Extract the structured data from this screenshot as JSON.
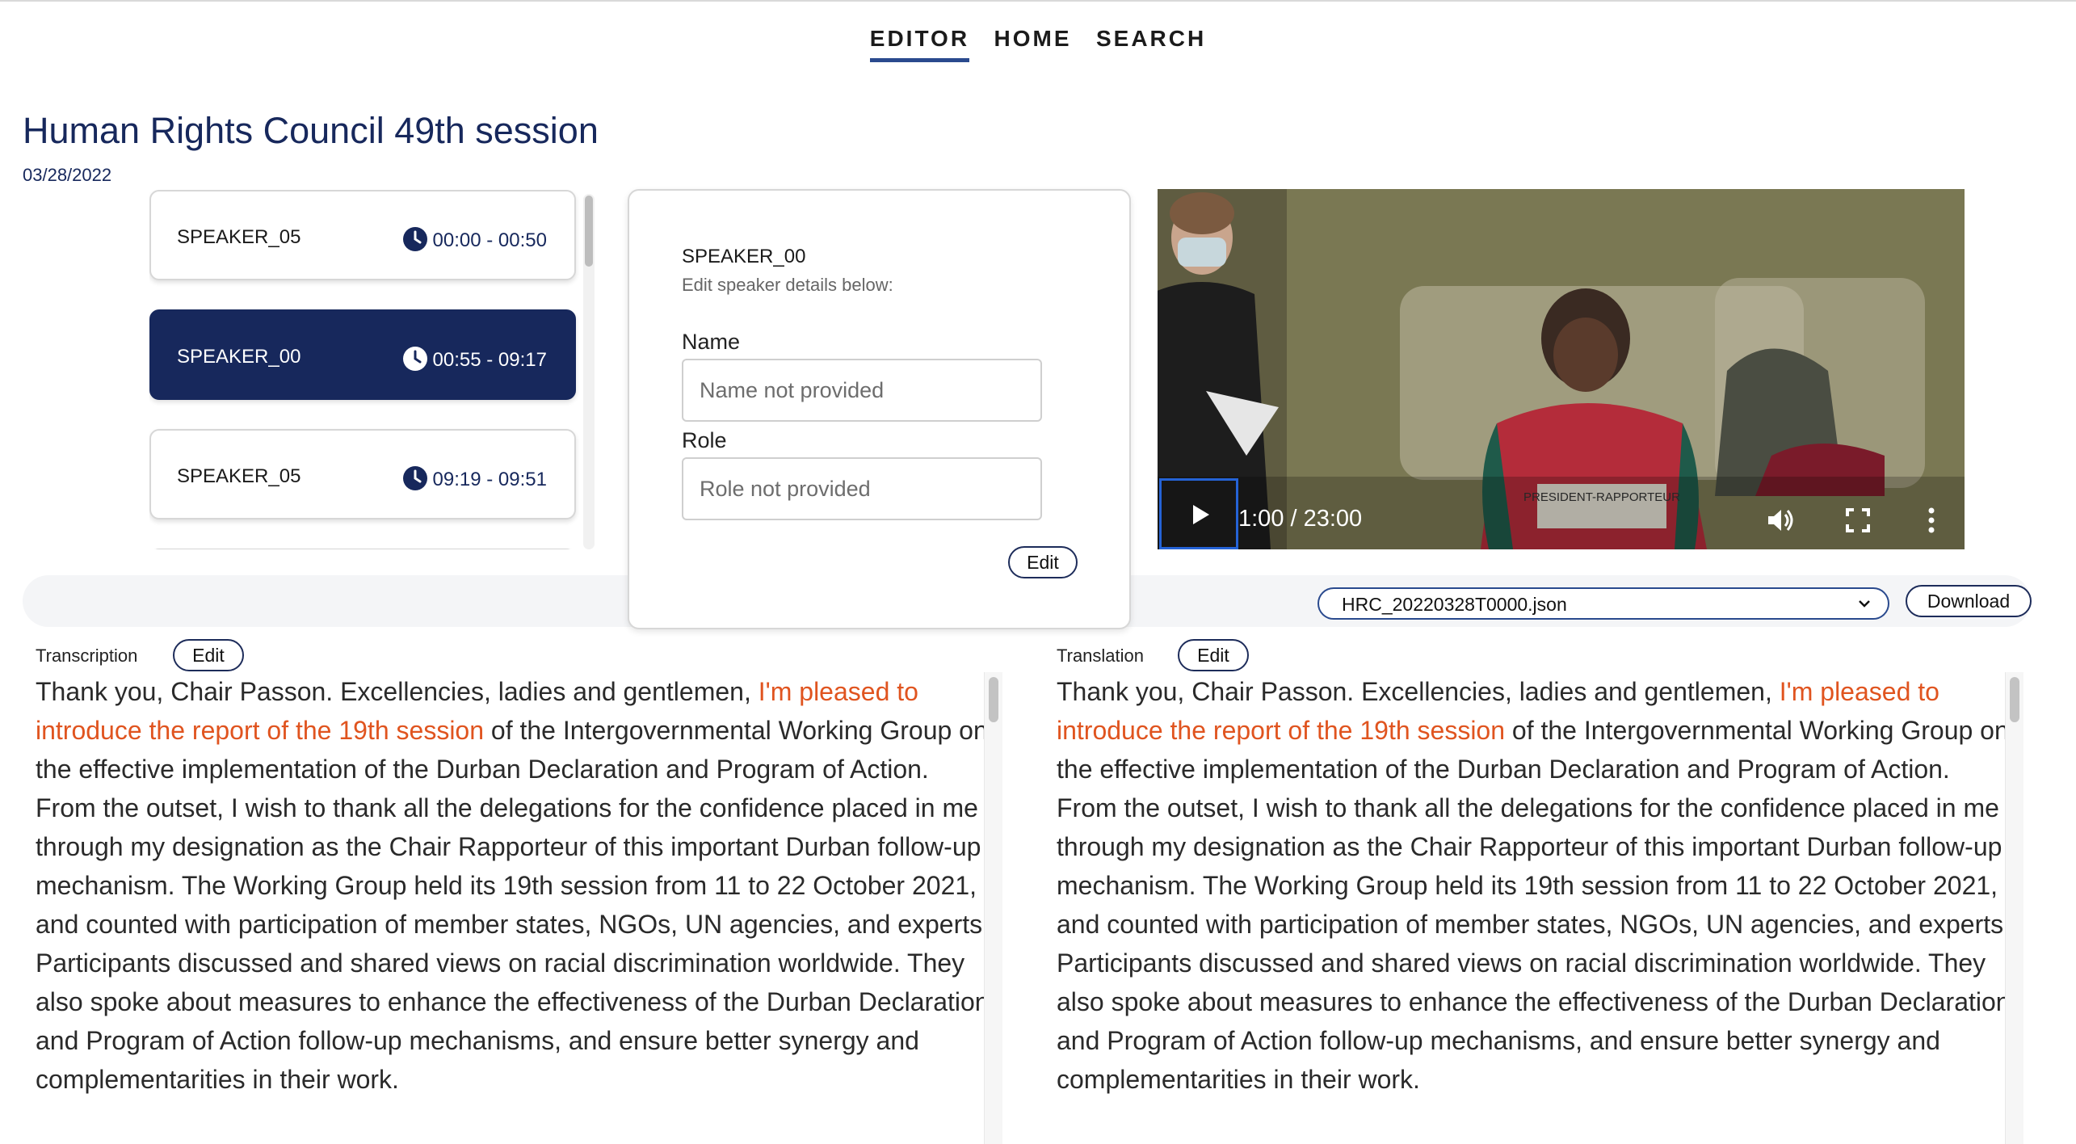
{
  "nav": {
    "items": [
      {
        "label": "EDITOR",
        "active": true
      },
      {
        "label": "HOME",
        "active": false
      },
      {
        "label": "SEARCH",
        "active": false
      }
    ]
  },
  "session": {
    "title": "Human Rights Council 49th session",
    "date": "03/28/2022"
  },
  "speakers": [
    {
      "name": "SPEAKER_05",
      "time": "00:00 - 00:50",
      "selected": false
    },
    {
      "name": "SPEAKER_00",
      "time": "00:55 - 09:17",
      "selected": true
    },
    {
      "name": "SPEAKER_05",
      "time": "09:19 - 09:51",
      "selected": false
    }
  ],
  "speaker_detail": {
    "speaker_id": "SPEAKER_00",
    "hint": "Edit speaker details below:",
    "name_label": "Name",
    "name_placeholder": "Name not provided",
    "role_label": "Role",
    "role_placeholder": "Role not provided",
    "edit_label": "Edit"
  },
  "video": {
    "time_display": "1:00 / 23:00",
    "placard_text": "PRESIDENT-RAPPORTEUR"
  },
  "toolbar": {
    "file_selected": "HRC_20220328T0000.json",
    "download_label": "Download"
  },
  "transcription": {
    "label": "Transcription",
    "edit_label": "Edit",
    "text_before": "Thank you, Chair Passon. Excellencies, ladies and gentlemen, ",
    "text_highlight": "I'm pleased to introduce the report of the 19th session",
    "text_after": " of the Intergovernmental Working Group on the effective implementation of the Durban Declaration and Program of Action. From the outset, I wish to thank all the delegations for the confidence placed in me through my designation as the Chair Rapporteur of this important Durban follow-up mechanism. The Working Group held its 19th session from 11 to 22 October 2021, and counted with participation of member states, NGOs, UN agencies, and experts. Participants discussed and shared views on racial discrimination worldwide. They also spoke about measures to enhance the effectiveness of the Durban Declaration and Program of Action follow-up mechanisms, and ensure better synergy and complementarities in their work."
  },
  "translation": {
    "label": "Translation",
    "edit_label": "Edit",
    "text_before": "Thank you, Chair Passon. Excellencies, ladies and gentlemen, ",
    "text_highlight": "I'm pleased to introduce the report of the 19th session",
    "text_after": " of the Intergovernmental Working Group on the effective implementation of the Durban Declaration and Program of Action. From the outset, I wish to thank all the delegations for the confidence placed in me through my designation as the Chair Rapporteur of this important Durban follow-up mechanism. The Working Group held its 19th session from 11 to 22 October 2021, and counted with participation of member states, NGOs, UN agencies, and experts. Participants discussed and shared views on racial discrimination worldwide. They also spoke about measures to enhance the effectiveness of the Durban Declaration and Program of Action follow-up mechanisms, and ensure better synergy and complementarities in their work."
  },
  "colors": {
    "primary_navy": "#17285c",
    "highlight_orange": "#e0541f",
    "accent_blue": "#2a4a8e"
  }
}
